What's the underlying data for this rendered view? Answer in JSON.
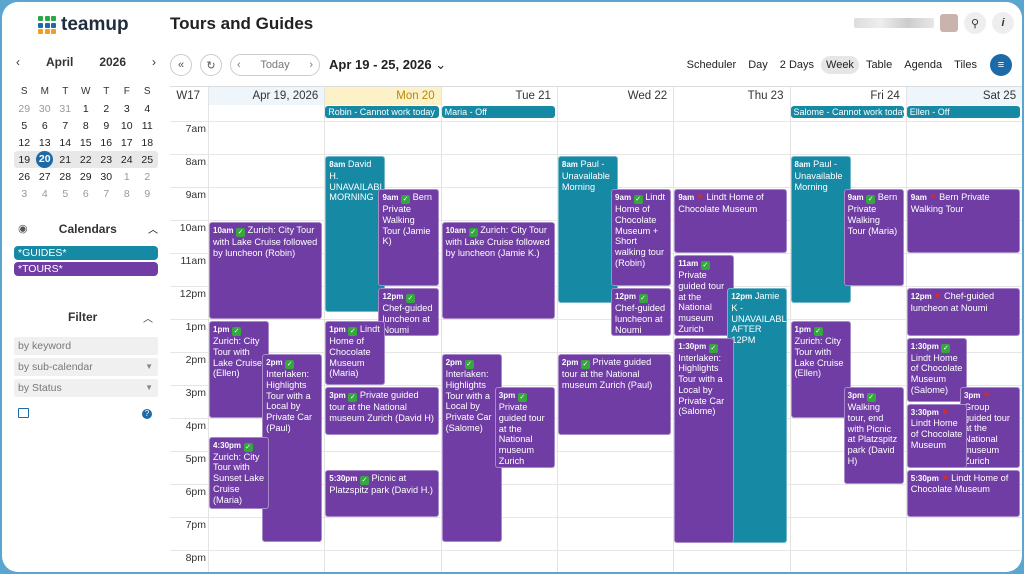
{
  "app": {
    "name": "teamup",
    "page_title": "Tours and Guides"
  },
  "colors": {
    "guides": "#1689a4",
    "tours": "#6f3da4",
    "accent": "#1c6aa8"
  },
  "header": {
    "search_icon": "search-icon",
    "info_icon": "info-icon",
    "search_glyph": "⚲",
    "info_glyph": "i"
  },
  "mini_calendar": {
    "month": "April",
    "year": "2026",
    "prev": "‹",
    "next": "›",
    "weekdays": [
      "S",
      "M",
      "T",
      "W",
      "T",
      "F",
      "S"
    ],
    "weeks": [
      [
        "29",
        "30",
        "31",
        "1",
        "2",
        "3",
        "4"
      ],
      [
        "5",
        "6",
        "7",
        "8",
        "9",
        "10",
        "11"
      ],
      [
        "12",
        "13",
        "14",
        "15",
        "16",
        "17",
        "18"
      ],
      [
        "19",
        "20",
        "21",
        "22",
        "23",
        "24",
        "25"
      ],
      [
        "26",
        "27",
        "28",
        "29",
        "30",
        "1",
        "2"
      ],
      [
        "3",
        "4",
        "5",
        "6",
        "7",
        "8",
        "9"
      ]
    ],
    "today": "20"
  },
  "calendars": {
    "title": "Calendars",
    "items": [
      {
        "label": "*GUIDES*"
      },
      {
        "label": "*TOURS*"
      }
    ]
  },
  "filter": {
    "title": "Filter",
    "keyword_placeholder": "by keyword",
    "subcal": "by sub-calendar",
    "status": "by Status"
  },
  "toolbar": {
    "today": "Today",
    "date_range": "Apr 19 - 25, 2026",
    "first": "«",
    "refresh": "↻",
    "prev": "‹",
    "next": "›",
    "chevron": "⌄",
    "views": [
      "Scheduler",
      "Day",
      "2 Days",
      "Week",
      "Table",
      "Agenda",
      "Tiles"
    ],
    "active_view": "Week",
    "menu_glyph": "≡"
  },
  "grid": {
    "week_label": "W17",
    "days": [
      "Apr 19, 2026",
      "Mon 20",
      "Tue 21",
      "Wed 22",
      "Thu 23",
      "Fri 24",
      "Sat 25"
    ],
    "hours": [
      "7am",
      "8am",
      "9am",
      "10am",
      "11am",
      "12pm",
      "1pm",
      "2pm",
      "3pm",
      "4pm",
      "5pm",
      "6pm",
      "7pm",
      "8pm"
    ],
    "banners": [
      {
        "day": 1,
        "text": "Robin - Cannot work today",
        "cal": "guides"
      },
      {
        "day": 2,
        "text": "Maria - Off",
        "cal": "guides"
      },
      {
        "day": 5,
        "text": "Salome - Cannot work today",
        "cal": "guides"
      },
      {
        "day": 6,
        "text": "Ellen - Off",
        "cal": "guides"
      }
    ],
    "events": [
      {
        "day": 0,
        "col": 0,
        "cols": 1,
        "start": 10,
        "end": 13,
        "time": "10am",
        "check": true,
        "title": "Zurich: City Tour with Lake Cruise followed by luncheon (Robin)",
        "cal": "tours"
      },
      {
        "day": 0,
        "col": 0,
        "cols": 2,
        "start": 13,
        "end": 16,
        "time": "1pm",
        "check": true,
        "title": "Zurich: City Tour with Lake Cruise (Ellen)",
        "cal": "tours"
      },
      {
        "day": 0,
        "col": 1,
        "cols": 2,
        "start": 14,
        "end": 19.75,
        "time": "2pm",
        "check": true,
        "title": "Interlaken: Highlights Tour with a Local by Private Car (Paul)",
        "cal": "tours"
      },
      {
        "day": 0,
        "col": 0,
        "cols": 2,
        "start": 16.5,
        "end": 18.75,
        "time": "4:30pm",
        "check": true,
        "title": "Zurich: City Tour with Sunset Lake Cruise (Maria)",
        "cal": "tours"
      },
      {
        "day": 1,
        "col": 0,
        "cols": 2,
        "start": 8,
        "end": 12.8,
        "time": "8am",
        "check": false,
        "title": "David H. UNAVAILABLE MORNING",
        "cal": "guides"
      },
      {
        "day": 1,
        "col": 1,
        "cols": 2,
        "start": 9,
        "end": 12,
        "time": "9am",
        "check": true,
        "title": "Bern Private Walking Tour (Jamie K)",
        "cal": "tours"
      },
      {
        "day": 1,
        "col": 1,
        "cols": 2,
        "start": 12,
        "end": 13.5,
        "time": "12pm",
        "check": true,
        "title": "Chef-guided luncheon at Noumi",
        "cal": "tours"
      },
      {
        "day": 1,
        "col": 0,
        "cols": 2,
        "start": 13,
        "end": 15,
        "time": "1pm",
        "check": true,
        "title": "Lindt Home of Chocolate Museum (Maria)",
        "cal": "tours"
      },
      {
        "day": 1,
        "col": 0,
        "cols": 1,
        "start": 15,
        "end": 16.5,
        "time": "3pm",
        "check": true,
        "title": "Private guided tour at the National museum Zurich (David H)",
        "cal": "tours"
      },
      {
        "day": 1,
        "col": 0,
        "cols": 1,
        "start": 17.5,
        "end": 19,
        "time": "5:30pm",
        "check": true,
        "title": "Picnic at Platzspitz park (David H.)",
        "cal": "tours"
      },
      {
        "day": 2,
        "col": 0,
        "cols": 1,
        "start": 10,
        "end": 13,
        "time": "10am",
        "check": true,
        "title": "Zurich: City Tour with Lake Cruise followed by luncheon (Jamie K.)",
        "cal": "tours"
      },
      {
        "day": 2,
        "col": 0,
        "cols": 2,
        "start": 14,
        "end": 19.75,
        "time": "2pm",
        "check": true,
        "title": "Interlaken: Highlights Tour with a Local by Private Car (Salome)",
        "cal": "tours"
      },
      {
        "day": 2,
        "col": 1,
        "cols": 2,
        "start": 15,
        "end": 17.5,
        "time": "3pm",
        "check": true,
        "title": "Private guided tour at the National museum Zurich (David H)",
        "cal": "tours"
      },
      {
        "day": 3,
        "col": 0,
        "cols": 2,
        "start": 8,
        "end": 12.5,
        "time": "8am",
        "check": false,
        "title": "Paul - Unavailable Morning",
        "cal": "guides"
      },
      {
        "day": 3,
        "col": 1,
        "cols": 2,
        "start": 9,
        "end": 12,
        "time": "9am",
        "check": true,
        "title": "Lindt Home of Chocolate Museum + Short walking tour (Robin)",
        "cal": "tours"
      },
      {
        "day": 3,
        "col": 1,
        "cols": 2,
        "start": 12,
        "end": 13.5,
        "time": "12pm",
        "check": true,
        "title": "Chef-guided luncheon at Noumi",
        "cal": "tours"
      },
      {
        "day": 3,
        "col": 0,
        "cols": 1,
        "start": 14,
        "end": 16.5,
        "time": "2pm",
        "check": true,
        "title": "Private guided tour at the National museum Zurich (Paul)",
        "cal": "tours"
      },
      {
        "day": 4,
        "col": 0,
        "cols": 1,
        "start": 9,
        "end": 11,
        "time": "9am",
        "check": false,
        "flag": true,
        "title": "Lindt Home of Chocolate Museum",
        "cal": "tours"
      },
      {
        "day": 4,
        "col": 0,
        "cols": 2,
        "start": 11,
        "end": 13.5,
        "time": "11am",
        "check": true,
        "title": "Private guided tour at the National museum Zurich",
        "cal": "tours"
      },
      {
        "day": 4,
        "col": 1,
        "cols": 2,
        "start": 12,
        "end": 19.8,
        "time": "12pm",
        "check": false,
        "title": "Jamie K - UNAVAILABLE AFTER 12PM",
        "cal": "guides"
      },
      {
        "day": 4,
        "col": 0,
        "cols": 2,
        "start": 13.5,
        "end": 19.8,
        "time": "1:30pm",
        "check": true,
        "title": "Interlaken: Highlights Tour with a Local by Private Car (Salome)",
        "cal": "tours"
      },
      {
        "day": 5,
        "col": 0,
        "cols": 2,
        "start": 8,
        "end": 12.5,
        "time": "8am",
        "check": false,
        "title": "Paul - Unavailable Morning",
        "cal": "guides"
      },
      {
        "day": 5,
        "col": 1,
        "cols": 2,
        "start": 9,
        "end": 12,
        "time": "9am",
        "check": true,
        "title": "Bern Private Walking Tour (Maria)",
        "cal": "tours"
      },
      {
        "day": 5,
        "col": 0,
        "cols": 2,
        "start": 13,
        "end": 16,
        "time": "1pm",
        "check": true,
        "title": "Zurich: City Tour with Lake Cruise (Ellen)",
        "cal": "tours"
      },
      {
        "day": 5,
        "col": 1,
        "cols": 2,
        "start": 15,
        "end": 18,
        "time": "3pm",
        "check": true,
        "title": "Walking tour, end with Picnic at Platzspitz park (David H)",
        "cal": "tours"
      },
      {
        "day": 6,
        "col": 0,
        "cols": 1,
        "start": 9,
        "end": 11,
        "time": "9am",
        "check": false,
        "flag": true,
        "title": "Bern Private Walking Tour",
        "cal": "tours"
      },
      {
        "day": 6,
        "col": 0,
        "cols": 1,
        "start": 12,
        "end": 13.5,
        "time": "12pm",
        "check": false,
        "flag": true,
        "title": "Chef-guided luncheon at Noumi",
        "cal": "tours"
      },
      {
        "day": 6,
        "col": 0,
        "cols": 2,
        "start": 13.5,
        "end": 15.5,
        "time": "1:30pm",
        "check": true,
        "title": "Lindt Home of Chocolate Museum (Salome)",
        "cal": "tours"
      },
      {
        "day": 6,
        "col": 1,
        "cols": 2,
        "start": 15,
        "end": 17.5,
        "time": "3pm",
        "check": false,
        "flag": true,
        "title": "Group guided tour at the National museum Zurich",
        "cal": "tours"
      },
      {
        "day": 6,
        "col": 0,
        "cols": 2,
        "start": 15.5,
        "end": 17.5,
        "time": "3:30pm",
        "check": false,
        "flag": true,
        "title": "Lindt Home of Chocolate Museum",
        "cal": "tours"
      },
      {
        "day": 6,
        "col": 0,
        "cols": 1,
        "start": 17.5,
        "end": 19,
        "time": "5:30pm",
        "check": false,
        "flag": true,
        "title": "Lindt Home of Chocolate Museum",
        "cal": "tours"
      }
    ]
  }
}
